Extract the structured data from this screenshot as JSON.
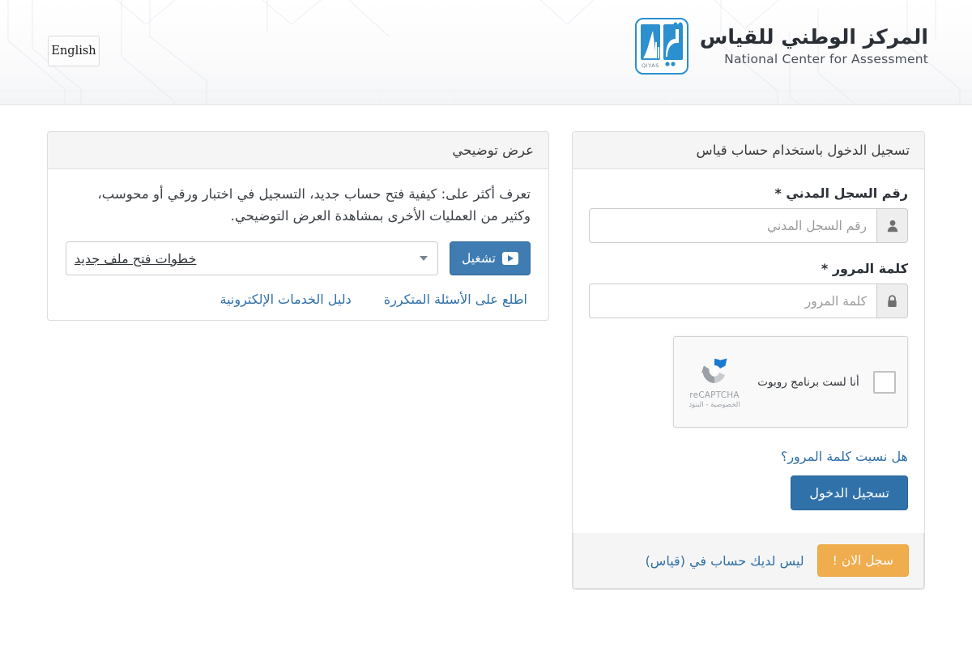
{
  "header": {
    "language_toggle": "English",
    "brand_arabic": "المركز الوطني للقياس",
    "brand_english": "National Center for Assessment",
    "logo_caption": "QIYAS",
    "logo_icon": "qiyas-logo-icon"
  },
  "demo_panel": {
    "title": "عرض توضيحي",
    "description": "تعرف أكثر على: كيفية فتح حساب جديد، التسجيل في اختبار ورقي أو محوسب، وكثير من العمليات الأخرى بمشاهدة العرض التوضيحي.",
    "select_value": "خطوات فتح ملف جديد",
    "select_icon": "chevron-down-icon",
    "play_button_label": "تشغيل",
    "play_icon": "play-icon",
    "links": [
      {
        "label": "اطلع على الأسئلة المتكررة"
      },
      {
        "label": "دليل الخدمات الإلكترونية"
      }
    ]
  },
  "login_panel": {
    "title": "تسجيل الدخول باستخدام حساب قياس",
    "civil_id": {
      "label": "رقم السجل المدني *",
      "placeholder": "رقم السجل المدني",
      "value": "",
      "icon": "user-icon"
    },
    "password": {
      "label": "كلمة المرور *",
      "placeholder": "كلمة المرور",
      "value": "",
      "icon": "lock-icon"
    },
    "recaptcha": {
      "label": "أنا لست برنامج روبوت",
      "brand": "reCAPTCHA",
      "terms": "الخصوصية - البنود",
      "icon": "recaptcha-icon",
      "checked": false
    },
    "forgot_password": "هل نسيت كلمة المرور؟",
    "submit_label": "تسجيل الدخول",
    "footer_text": "ليس لديك حساب في (قياس)",
    "register_label": "سجل الان !"
  },
  "colors": {
    "primary_blue": "#3071a9",
    "link_blue": "#2f6fa8",
    "accent_orange": "#f0ad4e",
    "panel_border": "#dddddd",
    "panel_heading_bg": "#f5f5f5"
  }
}
